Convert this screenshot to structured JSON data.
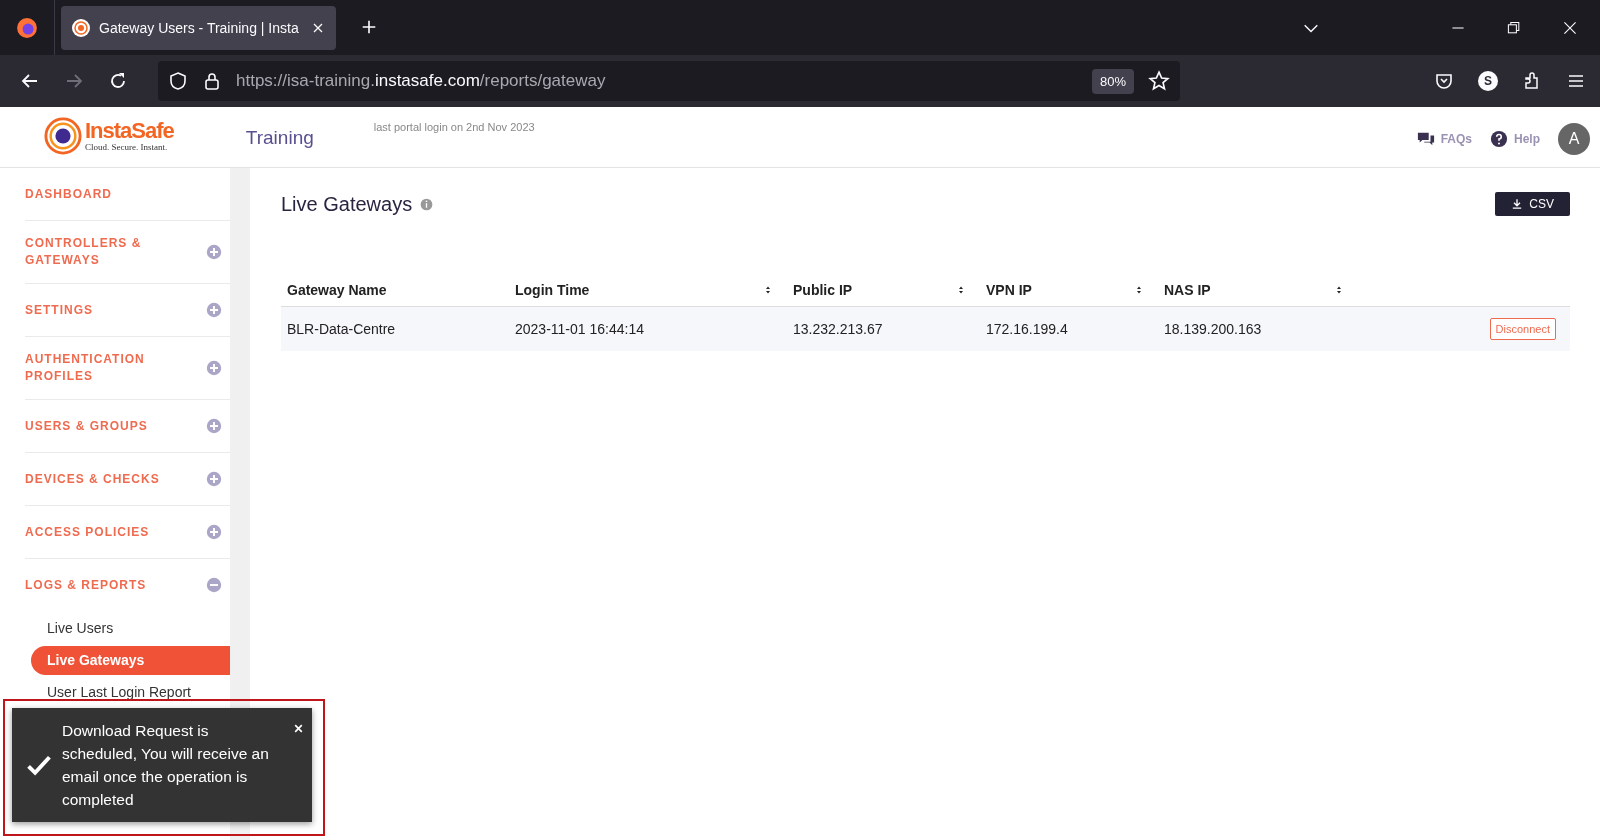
{
  "browser": {
    "tab_title": "Gateway Users - Training | Insta",
    "url_prefix": "https://isa-training.",
    "url_domain": "instasafe.com",
    "url_path": "/reports/gateway",
    "zoom": "80%",
    "profile_initial": "S"
  },
  "header": {
    "logo_name": "InstaSafe",
    "logo_tagline": "Cloud. Secure. Instant.",
    "portal": "Training",
    "last_login": "last portal login on 2nd Nov 2023",
    "faqs": "FAQs",
    "help": "Help",
    "avatar": "A"
  },
  "sidebar": {
    "items": [
      {
        "label": "DASHBOARD",
        "kind": "link"
      },
      {
        "label": "CONTROLLERS & GATEWAYS",
        "kind": "group",
        "expanded": false
      },
      {
        "label": "SETTINGS",
        "kind": "group",
        "expanded": false
      },
      {
        "label": "AUTHENTICATION PROFILES",
        "kind": "group",
        "expanded": false
      },
      {
        "label": "USERS & GROUPS",
        "kind": "group",
        "expanded": false
      },
      {
        "label": "DEVICES & CHECKS",
        "kind": "group",
        "expanded": false
      },
      {
        "label": "ACCESS POLICIES",
        "kind": "group",
        "expanded": false
      },
      {
        "label": "LOGS & REPORTS",
        "kind": "group",
        "expanded": true,
        "children": [
          {
            "label": "Live Users",
            "selected": false
          },
          {
            "label": "Live Gateways",
            "selected": true
          },
          {
            "label": "User Last Login Report",
            "selected": false
          }
        ]
      }
    ]
  },
  "page": {
    "title": "Live Gateways",
    "csv_button": "CSV"
  },
  "table": {
    "columns": [
      {
        "label": "Gateway Name",
        "sortable": false
      },
      {
        "label": "Login Time",
        "sortable": true
      },
      {
        "label": "Public IP",
        "sortable": true
      },
      {
        "label": "VPN IP",
        "sortable": true
      },
      {
        "label": "NAS IP",
        "sortable": true
      }
    ],
    "rows": [
      {
        "cells": [
          "BLR-Data-Centre",
          "2023-11-01 16:44:14",
          "13.232.213.67",
          "172.16.199.4",
          "18.139.200.163"
        ],
        "action": "Disconnect"
      }
    ]
  },
  "toast": {
    "message": "Download Request is scheduled, You will receive an email once the operation is completed",
    "highlighted": true
  }
}
